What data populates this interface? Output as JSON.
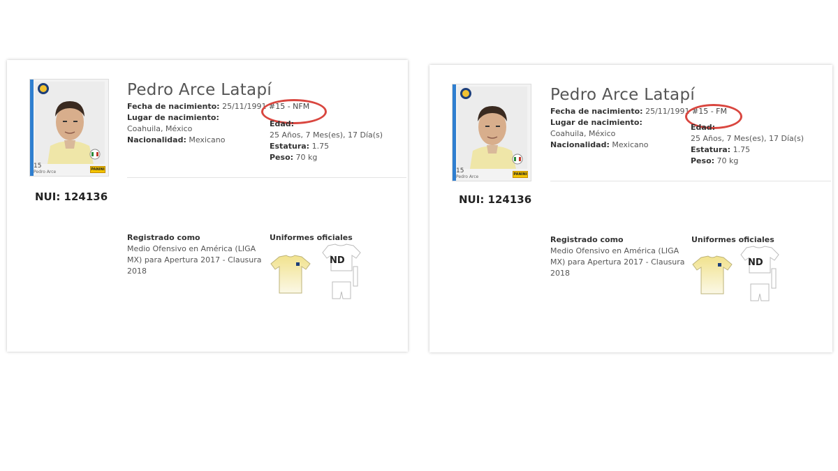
{
  "panels": [
    {
      "name": "Pedro Arce Latapí",
      "dob_label": "Fecha de nacimiento:",
      "dob_value": "25/11/1991",
      "jersey": "#15 - NFM",
      "birthplace_label": "Lugar de nacimiento:",
      "birthplace_value": "Coahuila, México",
      "nationality_label": "Nacionalidad:",
      "nationality_value": "Mexicano",
      "age_label": "Edad:",
      "age_value": "25 Años, 7 Mes(es), 17 Día(s)",
      "height_label": "Estatura:",
      "height_value": "1.75",
      "weight_label": "Peso:",
      "weight_value": "70 kg",
      "nui": "NUI: 124136",
      "registered_label": "Registrado como",
      "registered_value": "Medio Ofensivo en América (LIGA MX) para Apertura 2017 - Clausura 2018",
      "uniforms_label": "Uniformes oficiales",
      "uniform_nd": "ND",
      "sticker_number": "15",
      "sticker_name": "Pedro Arce",
      "sticker_brand": "PANINI"
    },
    {
      "name": "Pedro Arce Latapí",
      "dob_label": "Fecha de nacimiento:",
      "dob_value": "25/11/1991",
      "jersey": "#15 - FM",
      "birthplace_label": "Lugar de nacimiento:",
      "birthplace_value": "Coahuila, México",
      "nationality_label": "Nacionalidad:",
      "nationality_value": "Mexicano",
      "age_label": "Edad:",
      "age_value": "25 Años, 7 Mes(es), 17 Día(s)",
      "height_label": "Estatura:",
      "height_value": "1.75",
      "weight_label": "Peso:",
      "weight_value": "70 kg",
      "nui": "NUI: 124136",
      "registered_label": "Registrado como",
      "registered_value": "Medio Ofensivo en América (LIGA MX) para Apertura 2017 - Clausura 2018",
      "uniforms_label": "Uniformes oficiales",
      "uniform_nd": "ND",
      "sticker_number": "15",
      "sticker_name": "Pedro Arce",
      "sticker_brand": "PANINI"
    }
  ],
  "colors": {
    "highlight_oval": "#d9463f",
    "sticker_stripe": "#2f7fd0",
    "home_kit": "#f3e9a6"
  }
}
